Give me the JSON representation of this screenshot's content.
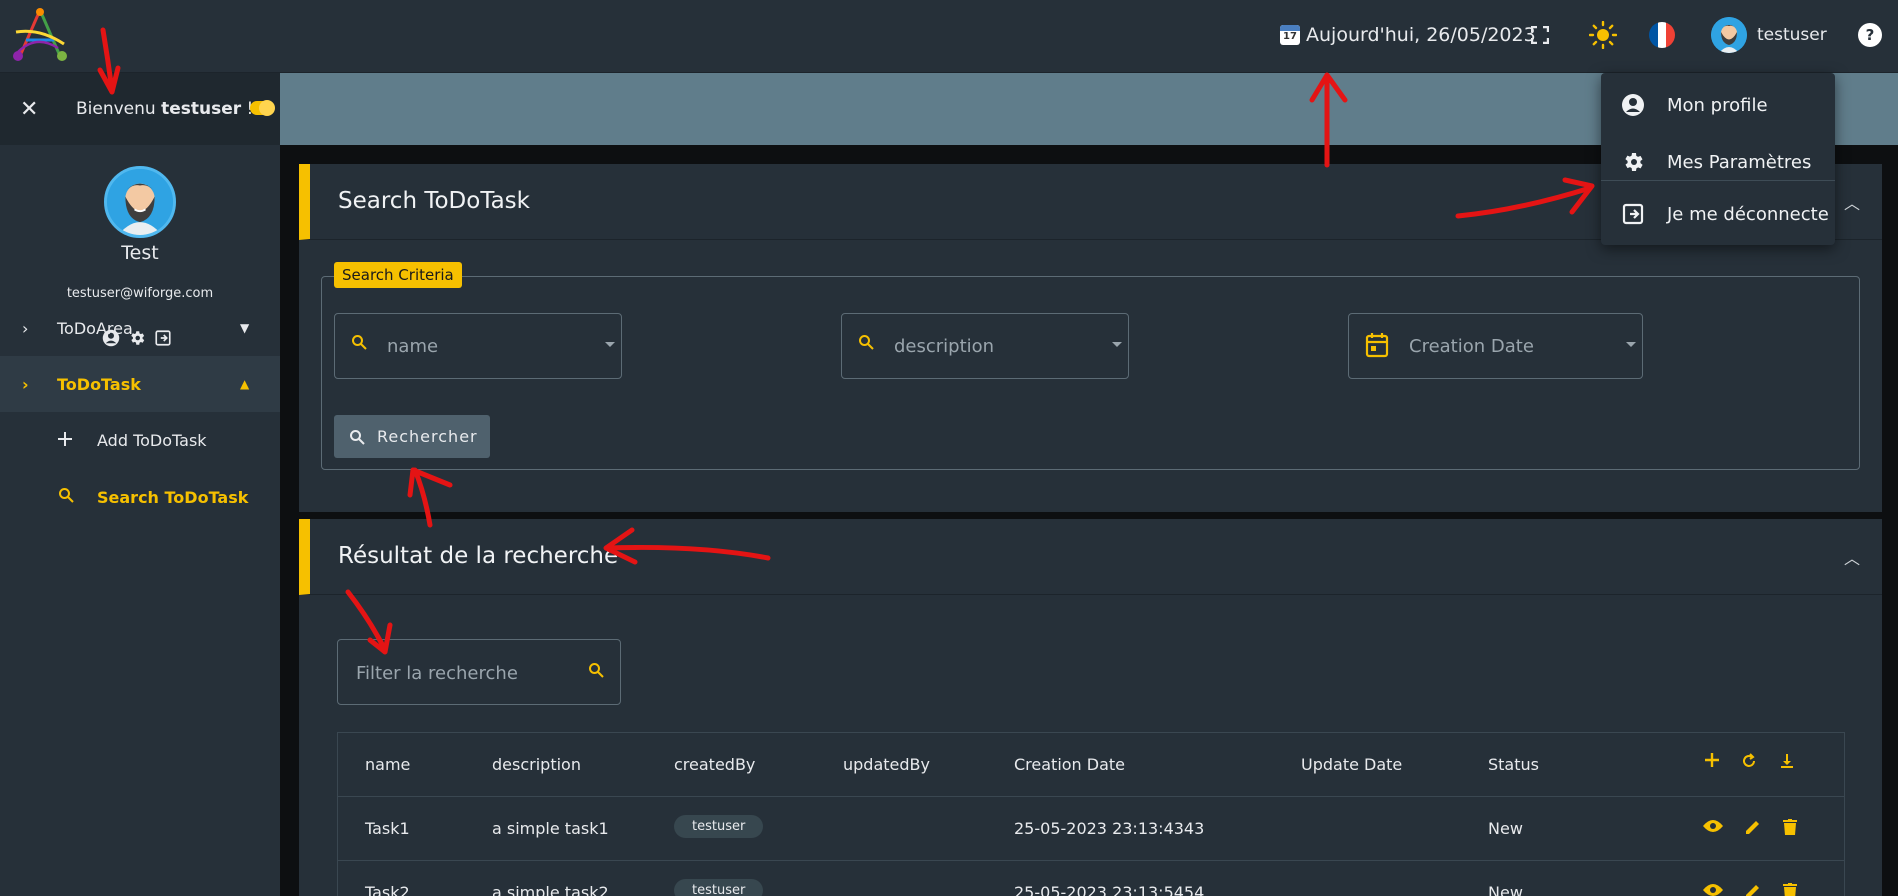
{
  "topbar": {
    "date_icon_text": "JUL 17",
    "date_text": "Aujourd'hui, 26/05/2023",
    "user_name": "testuser",
    "flag_colors": [
      "#0055a4",
      "#ffffff",
      "#ef4135"
    ],
    "accent": "#f6c000"
  },
  "sidebar": {
    "welcome_prefix": "Bienvenu ",
    "welcome_user": "testuser",
    "welcome_suffix": " !",
    "profile_name": "Test",
    "profile_email": "testuser@wiforge.com",
    "items": [
      {
        "label": "ToDoArea",
        "icon": "chevron-right-icon"
      },
      {
        "label": "ToDoTask",
        "icon": "chevron-right-icon"
      }
    ],
    "subitems": [
      {
        "label": "Add ToDoTask",
        "icon": "plus-icon"
      },
      {
        "label": "Search ToDoTask",
        "icon": "search-icon"
      }
    ]
  },
  "search_card": {
    "title": "Search ToDoTask",
    "legend": "Search Criteria",
    "fields": [
      {
        "placeholder": "name",
        "icon": "search-icon"
      },
      {
        "placeholder": "description",
        "icon": "search-icon"
      },
      {
        "placeholder": "Creation Date",
        "icon": "calendar-icon"
      }
    ],
    "button_label": "Rechercher"
  },
  "result_card": {
    "title": "Résultat de la recherche",
    "filter_placeholder": "Filter la recherche",
    "columns": [
      "name",
      "description",
      "createdBy",
      "updatedBy",
      "Creation Date",
      "Update Date",
      "Status"
    ],
    "rows": [
      {
        "name": "Task1",
        "description": "a simple task1",
        "createdBy": "testuser",
        "updatedBy": "",
        "creation": "25-05-2023 23:13:4343",
        "update": "",
        "status": "New"
      },
      {
        "name": "Task2",
        "description": "a simple task2",
        "createdBy": "testuser",
        "updatedBy": "",
        "creation": "25-05-2023 23:13:5454",
        "update": "",
        "status": "New"
      }
    ]
  },
  "user_menu": {
    "items": [
      {
        "label": "Mon profile",
        "icon": "account-circle-icon"
      },
      {
        "label": "Mes Paramètres",
        "icon": "gear-icon"
      },
      {
        "label": "Je me déconnecte",
        "icon": "logout-icon"
      }
    ]
  }
}
